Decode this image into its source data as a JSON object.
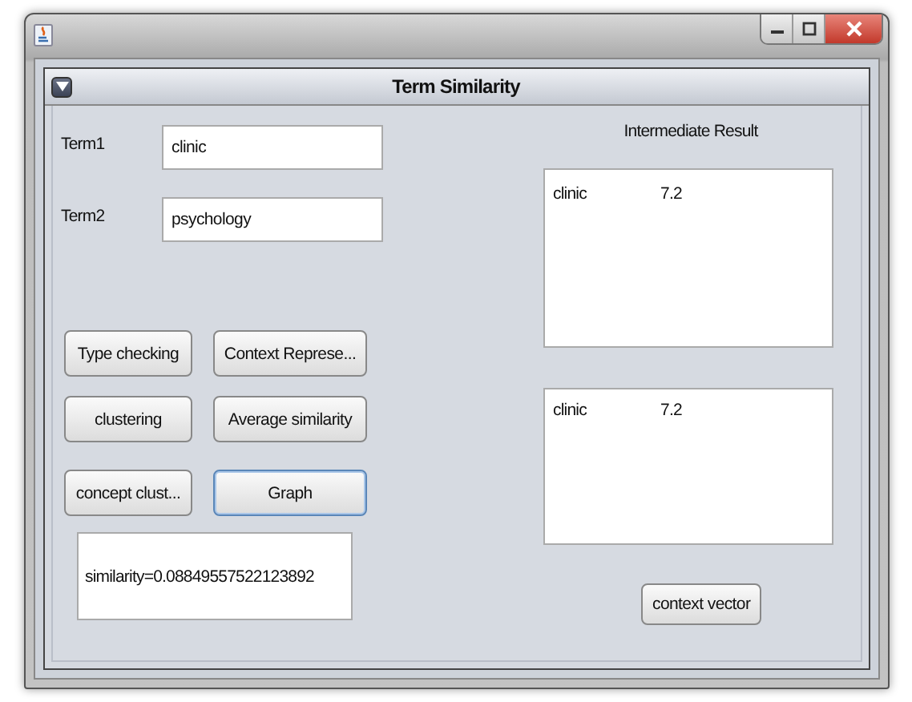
{
  "frame": {
    "title": "Term Similarity"
  },
  "fields": [
    {
      "label": "Term1",
      "value": "clinic"
    },
    {
      "label": "Term2",
      "value": "psychology"
    }
  ],
  "buttons": [
    {
      "label": "Type checking",
      "focused": false
    },
    {
      "label": "Context Represe...",
      "focused": false
    },
    {
      "label": "clustering",
      "focused": false
    },
    {
      "label": "Average similarity",
      "focused": false
    },
    {
      "label": "concept clust...",
      "focused": false
    },
    {
      "label": "Graph",
      "focused": true
    }
  ],
  "result": "similarity=0.08849557522123892",
  "intermediate": {
    "heading": "Intermediate Result",
    "lists": [
      [
        {
          "term": "clinic",
          "value": "7.2"
        }
      ],
      [
        {
          "term": "clinic",
          "value": "7.2"
        }
      ]
    ],
    "button": "context vector"
  }
}
